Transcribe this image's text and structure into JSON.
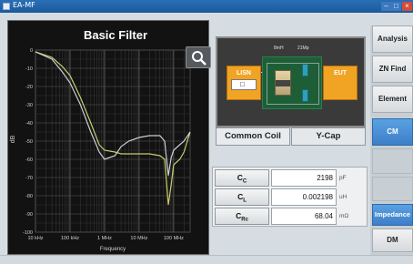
{
  "window": {
    "title": "EA-MF"
  },
  "chart": {
    "title": "Basic Filter",
    "ylabel": "dB",
    "xlabel": "Frequency",
    "y_ticks": [
      "0",
      "-10",
      "-20",
      "-30",
      "-40",
      "-50",
      "-60",
      "-70",
      "-80",
      "-90",
      "-100"
    ],
    "x_ticks": [
      "10 kHz",
      "100 kHz",
      "1 MHz",
      "10 MHz",
      "100 MHz"
    ]
  },
  "chart_data": {
    "type": "line",
    "title": "Basic Filter",
    "xlabel": "Frequency",
    "ylabel": "dB",
    "xscale": "log",
    "xlim": [
      10000,
      300000000
    ],
    "ylim": [
      -100,
      0
    ],
    "grid": true,
    "series": [
      {
        "x": [
          10000,
          30000,
          60000,
          100000,
          200000,
          400000,
          700000,
          1000000,
          2000000,
          3000000,
          5000000,
          10000000,
          20000000,
          40000000,
          55000000,
          70000000,
          85000000,
          100000000,
          150000000,
          200000000,
          300000000
        ],
        "values": [
          -1,
          -4,
          -9,
          -14,
          -26,
          -40,
          -52,
          -55,
          -56,
          -57,
          -57,
          -57,
          -57,
          -58,
          -60,
          -85,
          -74,
          -63,
          -60,
          -56,
          -45
        ]
      },
      {
        "x": [
          10000,
          30000,
          60000,
          100000,
          200000,
          400000,
          700000,
          1000000,
          2000000,
          3000000,
          5000000,
          10000000,
          20000000,
          40000000,
          55000000,
          70000000,
          85000000,
          100000000,
          150000000,
          200000000,
          300000000
        ],
        "values": [
          -1,
          -5,
          -12,
          -18,
          -30,
          -45,
          -56,
          -60,
          -58,
          -53,
          -50,
          -48,
          -47,
          -47,
          -50,
          -69,
          -59,
          -55,
          -52,
          -50,
          -45
        ]
      }
    ],
    "colors": [
      "#c8cc6a",
      "#c9cfd4"
    ]
  },
  "schematic": {
    "lisn_label": "LISN",
    "eut_label": "EUT",
    "coil_text": "8mH",
    "cap_text": "21Mp",
    "lisn_indicator": "□"
  },
  "tabs": {
    "common": "Common Coil",
    "ycap": "Y-Cap"
  },
  "params": [
    {
      "label": "C_C",
      "value": "2198",
      "unit": "pF"
    },
    {
      "label": "C_L",
      "value": "0.002198",
      "unit": "uH"
    },
    {
      "label": "C_Rc",
      "value": "68.04",
      "unit": "mΩ"
    }
  ],
  "sidebar": {
    "analysis": "Analysis",
    "zn_find": "ZN Find",
    "element": "Element",
    "cm": "CM",
    "impedance": "Impedance",
    "dm": "DM"
  }
}
